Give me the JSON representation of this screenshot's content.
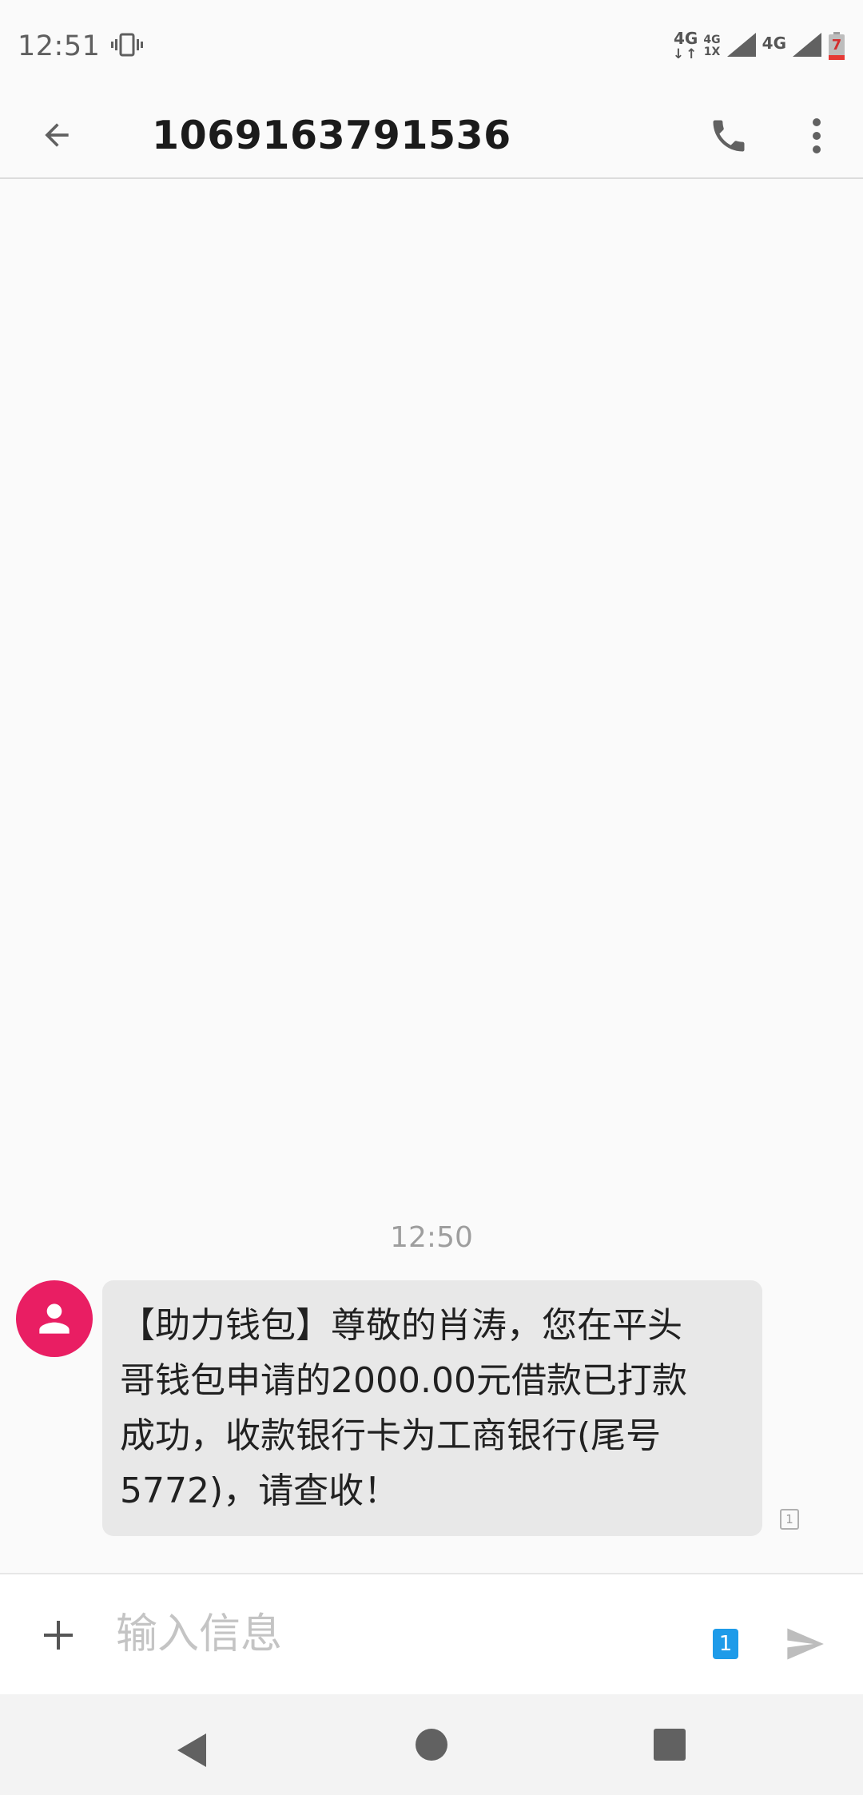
{
  "status_bar": {
    "time": "12:51",
    "vibrate_icon": "vibrate-icon",
    "net1": "4G",
    "net2_top": "4G",
    "net2_bottom": "1X",
    "net3": "4G",
    "battery": "7"
  },
  "header": {
    "title": "1069163791536",
    "back_icon": "arrow-back-icon",
    "call_icon": "phone-icon",
    "more_icon": "more-vert-icon"
  },
  "conversation": {
    "timestamp": "12:50",
    "message": {
      "line1": "【助力钱包】尊敬的肖涛，您在平头",
      "line2": "哥钱包申请的2000.00元借款已打款",
      "line3": "成功，收款银行卡为工商银行(尾号",
      "line4": "5772)，请查收！",
      "sim": "1"
    }
  },
  "composer": {
    "placeholder": "输入信息",
    "sim_selected": "1",
    "add_icon": "plus-icon",
    "send_icon": "send-icon"
  },
  "colors": {
    "accent": "#e91e63",
    "sim_badge": "#1e9be9",
    "bubble": "#e8e8e8"
  }
}
